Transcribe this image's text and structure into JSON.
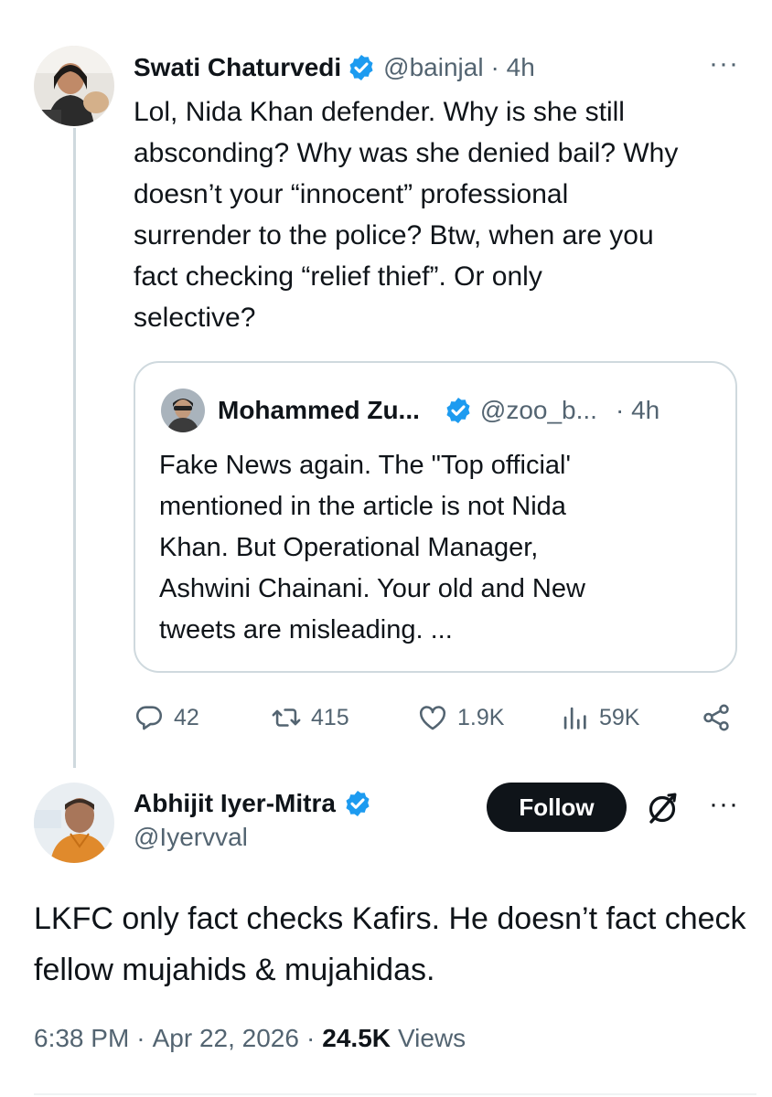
{
  "colors": {
    "text": "#0f1419",
    "muted": "#536471",
    "verified_blue": "#1d9bf0",
    "border": "#cfd9de",
    "follow_bg": "#0f1419"
  },
  "main_tweet": {
    "author_name": "Swati Chaturvedi",
    "handle": "@bainjal",
    "time": "· 4h",
    "more_label": "···",
    "text": "Lol, Nida Khan defender. Why is she still\nabsconding? Why was she denied bail? Why\ndoesn’t your “innocent” professional\nsurrender to the police? Btw, when are you\nfact checking “relief thief”. Or only\nselective?",
    "quoted": {
      "author_name": "Mohammed Zu...",
      "handle": "@zoo_b...",
      "time": "· 4h",
      "text": "Fake News again. The \"Top official'\nmentioned in the article is not Nida\nKhan. But Operational Manager,\nAshwini Chainani. Your old and New\ntweets are misleading. ..."
    },
    "actions": {
      "replies": "42",
      "reposts": "415",
      "likes": "1.9K",
      "views": "59K"
    },
    "icons": [
      "reply-icon",
      "repost-icon",
      "like-icon",
      "views-icon",
      "share-icon"
    ]
  },
  "reply_tweet": {
    "author_name": "Abhijit Iyer-Mitra",
    "handle": "@Iyervval",
    "follow_label": "Follow",
    "more_label": "···",
    "text": "LKFC only fact checks Kafirs. He doesn’t fact check fellow mujahids & mujahidas.",
    "time": "6:38 PM",
    "date": "Apr 22, 2026",
    "separator": "·",
    "views_count": "24.5K",
    "views_label": "Views"
  }
}
